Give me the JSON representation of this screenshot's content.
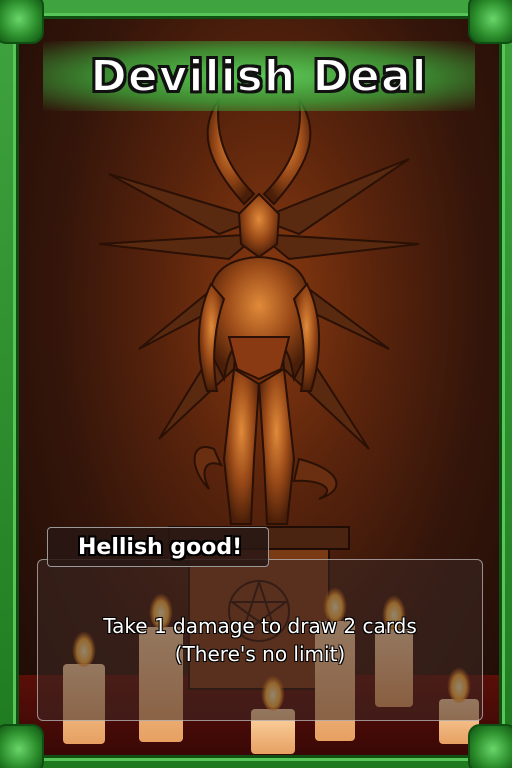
{
  "card": {
    "title": "Devilish Deal",
    "tagline": "Hellish good!",
    "description_lines": [
      "Take 1 damage to draw 2 cards",
      "(There's no limit)"
    ]
  },
  "colors": {
    "frame_green": "#2c8f2c",
    "banner_glow": "#5ad25a",
    "background": "#34150a"
  },
  "icons": [
    "demon-statue-illustration",
    "candle-icon",
    "pentagram-icon"
  ]
}
